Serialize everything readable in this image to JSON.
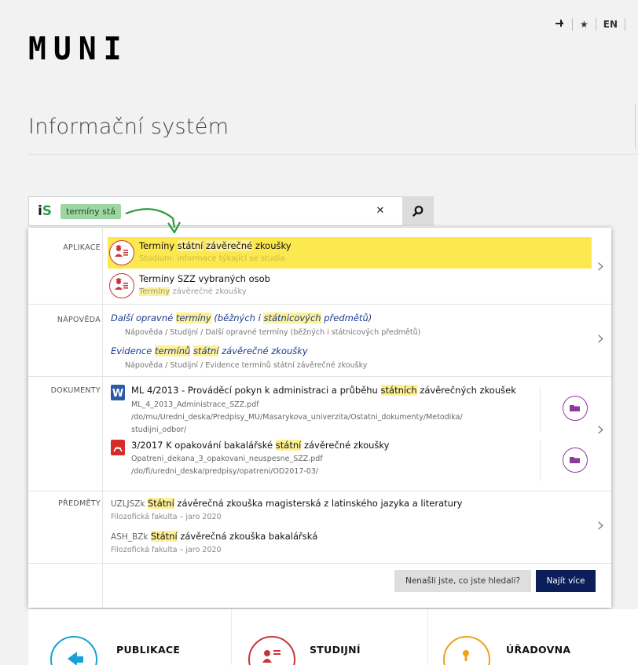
{
  "header": {
    "logo": "MUNI",
    "language": "EN",
    "title": "Informační systém"
  },
  "search": {
    "query": "termíny stá"
  },
  "sections": {
    "apps": {
      "label": "APLIKACE",
      "items": [
        {
          "t1": "Termíny ",
          "t2": "státní",
          "t3": " ",
          "t4": "závěrečné",
          "t5": " zkoušky",
          "sub": "Studium: informace týkající se studia"
        },
        {
          "t1": "Termíny SZZ vybraných osob",
          "sub_hl": "Termíny",
          "sub_rest": " závěrečné zkoušky"
        }
      ]
    },
    "help": {
      "label": "NÁPOVĚDA",
      "items": [
        {
          "t1": "Další opravné ",
          "t2": "termíny",
          "t3": " (běžných i ",
          "t4": "státnicových",
          "t5": " předmětů)",
          "path": "Nápověda / Studijní / Další opravné termíny (běžných i státnicových předmětů)"
        },
        {
          "t1": "Evidence ",
          "t2": "termínů",
          "t3": " ",
          "t4": "státní",
          "t5": " závěrečné zkoušky",
          "path": "Nápověda / Studijní / Evidence termínů státní závěrečné zkoušky"
        }
      ]
    },
    "docs": {
      "label": "DOKUMENTY",
      "items": [
        {
          "t1": "ML 4/2013 - Prováděcí pokyn k administraci a průběhu ",
          "t2": "státních",
          "t3": " závěrečných zkoušek",
          "file": "ML_4_2013_Administrace_SZZ.pdf",
          "path1": "/do/mu/Uredni_deska/Predpisy_MU/Masarykova_univerzita/Ostatni_dokumenty/Metodika/",
          "path2": "studijni_odbor/"
        },
        {
          "t1": "3/2017 K opakování bakalářské ",
          "t2": "státní",
          "t3": " závěrečné zkoušky",
          "file": "Opatreni_dekana_3_opakovani_neuspesne_SZZ.pdf",
          "path1": "/do/fi/uredni_deska/predpisy/opatreni/OD2017-03/"
        }
      ]
    },
    "subjects": {
      "label": "PŘEDMĚTY",
      "items": [
        {
          "code": "UZLJSZk ",
          "hl": "Státní",
          "rest": " závěrečná zkouška magisterská z latinského jazyka a literatury",
          "sub": "Filozofická fakulta – jaro 2020"
        },
        {
          "code": "ASH_BZk ",
          "hl": "Státní",
          "rest": " závěrečná zkouška bakalářská",
          "sub": "Filozofická fakulta – jaro 2020"
        }
      ]
    }
  },
  "footer_buttons": {
    "not_found": "Nenašli jste, co jste hledali?",
    "more": "Najít více"
  },
  "tiles": [
    "PUBLIKACE",
    "STUDIJNÍ",
    "ÚŘADOVNA"
  ],
  "colors": {
    "highlight": "#fdf095",
    "active_row": "#fce94f",
    "query_chip": "#9ed5a3",
    "primary_button": "#0c1e5a",
    "help_link": "#1c3b8f",
    "app_icon": "#c9353a",
    "folder_icon": "#8a3b9c"
  }
}
